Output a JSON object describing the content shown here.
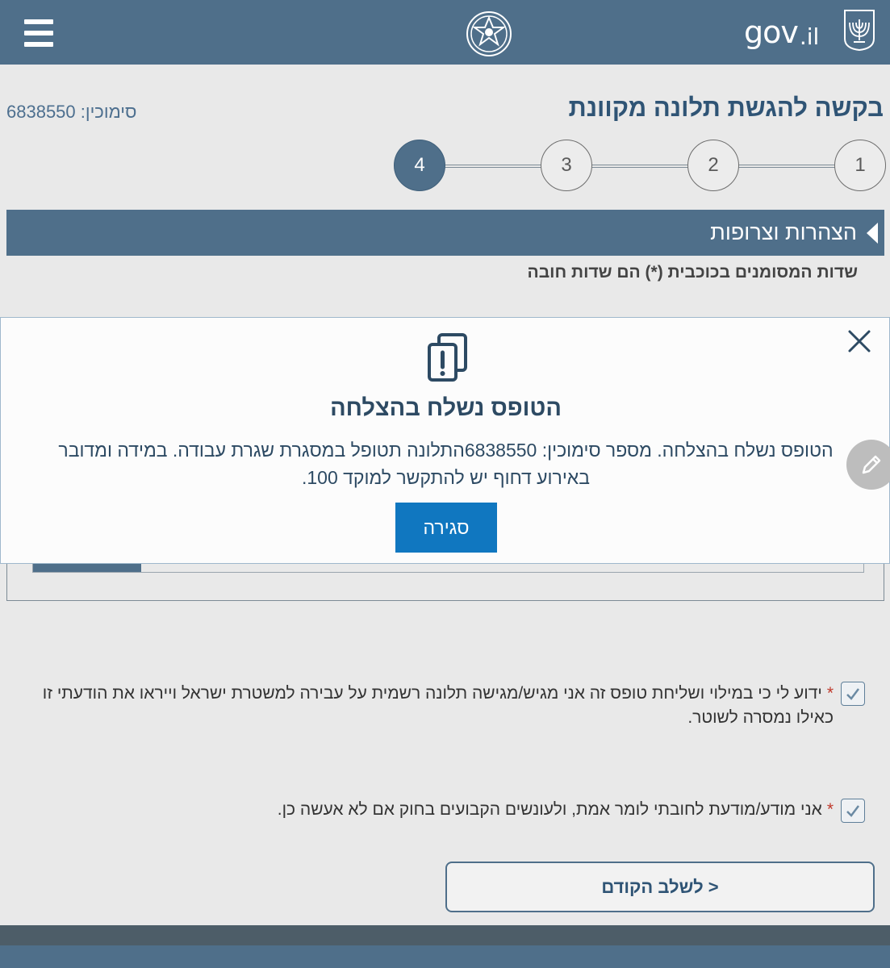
{
  "header": {
    "menu_icon": "hamburger-icon",
    "police_logo": "police-emblem-icon",
    "gov_logo_main": "gov",
    "gov_logo_suffix": ".il",
    "state_emblem": "menorah-emblem-icon",
    "bar_color": "#4f6f8a"
  },
  "page": {
    "title": "בקשה להגשת תלונה מקוונת",
    "reference": "סימוכין: 6838550"
  },
  "stepper": {
    "steps": [
      "1",
      "2",
      "3",
      "4"
    ],
    "active_step": "4"
  },
  "section": {
    "title": "הצהרות וצרופות",
    "required_note": "שדות המסומנים בכוכבית (*) הם שדות חובה"
  },
  "upload": {
    "progress_fraction": 0.13
  },
  "modal": {
    "icon": "documents-alert-icon",
    "title": "הטופס נשלח בהצלחה",
    "message": "הטופס נשלח בהצלחה. מספר סימוכין: 6838550התלונה תטופל במסגרת שגרת עבודה. במידה ומדובר באירוע דחוף יש להתקשר למוקד 100.",
    "close_button_label": "סגירה",
    "close_icon": "close-icon",
    "button_color": "#1077c0"
  },
  "declarations": [
    {
      "required_mark": "*",
      "text": "ידוע לי כי במילוי ושליחת טופס זה אני מגיש/מגישה תלונה רשמית על עבירה למשטרת ישראל וייראו את הודעתי זו כאילו נמסרה לשוטר.",
      "checked": true
    },
    {
      "required_mark": "*",
      "text": "אני מודע/מודעת לחובתי לומר אמת, ולעונשים הקבועים בחוק אם לא אעשה כן.",
      "checked": true
    }
  ],
  "navigation": {
    "previous_label": "< לשלב הקודם"
  }
}
